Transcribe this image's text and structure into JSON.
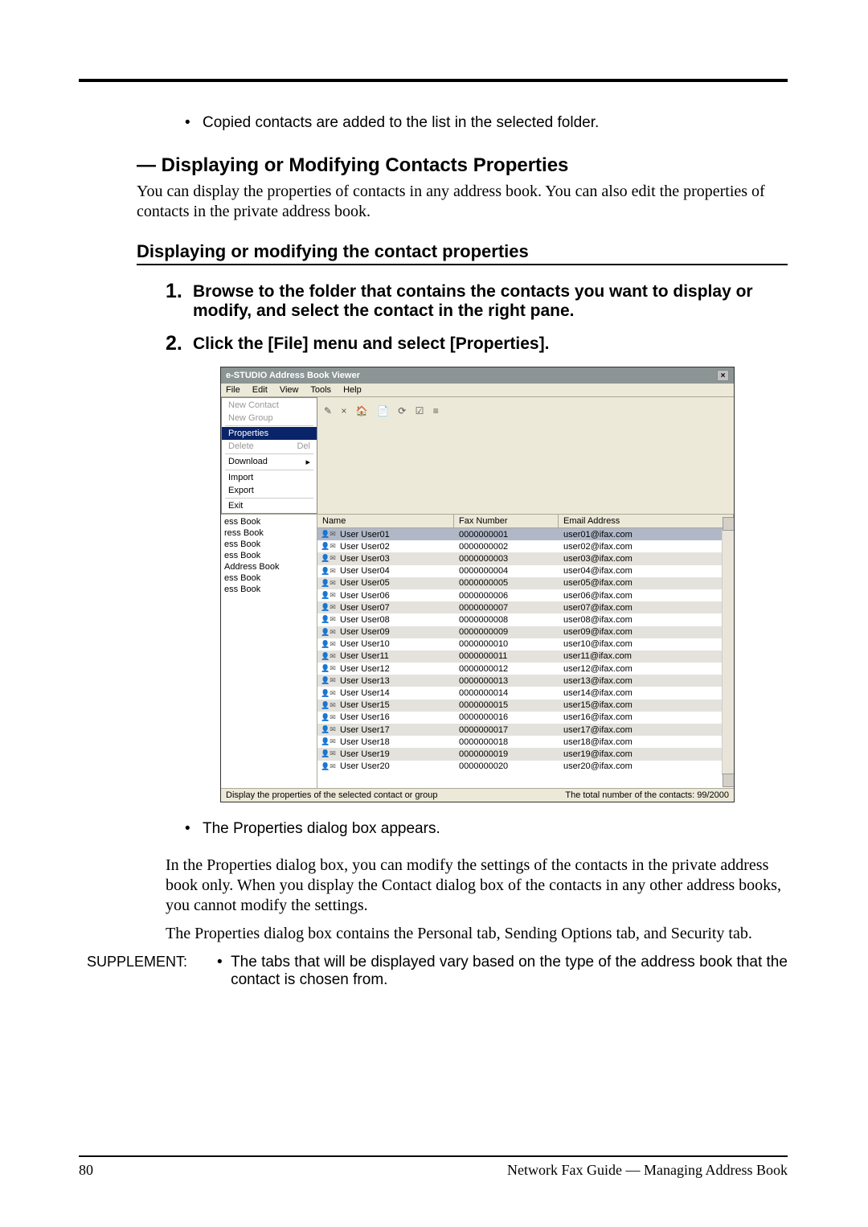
{
  "intro_bullet": "Copied contacts are added to the list in the selected folder.",
  "heading_display_modify": "— Displaying or Modifying Contacts Properties",
  "heading_desc": "You can display the properties of contacts in any address book.  You can also edit the properties of contacts in the private address book.",
  "sub_heading": "Displaying or modifying the contact properties",
  "steps": {
    "s1_num": "1.",
    "s1_text": "Browse to the folder that contains the contacts you want to display or modify, and select the contact in the right pane.",
    "s2_num": "2.",
    "s2_text": "Click the [File] menu and select [Properties]."
  },
  "screenshot": {
    "title": "e-STUDIO Address Book Viewer",
    "menus": [
      "File",
      "Edit",
      "View",
      "Tools",
      "Help"
    ],
    "file_menu": {
      "items": [
        {
          "label": "New Contact",
          "enabled": false
        },
        {
          "label": "New Group",
          "enabled": false
        },
        {
          "label": "Properties",
          "enabled": true,
          "highlight": true
        },
        {
          "label": "Delete",
          "enabled": false,
          "shortcut": "Del"
        },
        {
          "label": "Download",
          "enabled": true,
          "sub": true
        },
        {
          "label": "Import",
          "enabled": true
        },
        {
          "label": "Export",
          "enabled": true
        },
        {
          "label": "Exit",
          "enabled": true
        }
      ]
    },
    "toolbar_glyphs": "✎  ×   🏠 📄  ⟳  ☑  ≡",
    "tree": [
      "ess Book",
      "ress Book",
      "ess Book",
      "ess Book",
      "Address Book",
      "ess Book",
      "ess Book"
    ],
    "columns": {
      "name": "Name",
      "fax": "Fax Number",
      "email": "Email Address"
    },
    "rows": [
      {
        "name": "User User01",
        "fax": "0000000001",
        "email": "user01@ifax.com",
        "sel": true
      },
      {
        "name": "User User02",
        "fax": "0000000002",
        "email": "user02@ifax.com"
      },
      {
        "name": "User User03",
        "fax": "0000000003",
        "email": "user03@ifax.com",
        "alt": true
      },
      {
        "name": "User User04",
        "fax": "0000000004",
        "email": "user04@ifax.com"
      },
      {
        "name": "User User05",
        "fax": "0000000005",
        "email": "user05@ifax.com",
        "alt": true
      },
      {
        "name": "User User06",
        "fax": "0000000006",
        "email": "user06@ifax.com"
      },
      {
        "name": "User User07",
        "fax": "0000000007",
        "email": "user07@ifax.com",
        "alt": true
      },
      {
        "name": "User User08",
        "fax": "0000000008",
        "email": "user08@ifax.com"
      },
      {
        "name": "User User09",
        "fax": "0000000009",
        "email": "user09@ifax.com",
        "alt": true
      },
      {
        "name": "User User10",
        "fax": "0000000010",
        "email": "user10@ifax.com"
      },
      {
        "name": "User User11",
        "fax": "0000000011",
        "email": "user11@ifax.com",
        "alt": true
      },
      {
        "name": "User User12",
        "fax": "0000000012",
        "email": "user12@ifax.com"
      },
      {
        "name": "User User13",
        "fax": "0000000013",
        "email": "user13@ifax.com",
        "alt": true
      },
      {
        "name": "User User14",
        "fax": "0000000014",
        "email": "user14@ifax.com"
      },
      {
        "name": "User User15",
        "fax": "0000000015",
        "email": "user15@ifax.com",
        "alt": true
      },
      {
        "name": "User User16",
        "fax": "0000000016",
        "email": "user16@ifax.com"
      },
      {
        "name": "User User17",
        "fax": "0000000017",
        "email": "user17@ifax.com",
        "alt": true
      },
      {
        "name": "User User18",
        "fax": "0000000018",
        "email": "user18@ifax.com"
      },
      {
        "name": "User User19",
        "fax": "0000000019",
        "email": "user19@ifax.com",
        "alt": true
      },
      {
        "name": "User User20",
        "fax": "0000000020",
        "email": "user20@ifax.com"
      }
    ],
    "status_left": "Display the properties of the selected contact or group",
    "status_right": "The total number of the contacts: 99/2000"
  },
  "after_screenshot_bullet": "The Properties dialog box appears.",
  "para1": "In the Properties dialog box, you can modify the settings of the contacts in the private address book only.  When you display the Contact dialog box of the contacts in any other address books, you cannot modify the settings.",
  "para2": "The Properties dialog box contains the Personal tab, Sending Options tab, and Security tab.",
  "supplement_label": "SUPPLEMENT:",
  "supplement_text": "The tabs that will be displayed vary based on the type of the address book that the contact is chosen from.",
  "footer": {
    "page": "80",
    "title": "Network Fax Guide — Managing Address Book"
  }
}
